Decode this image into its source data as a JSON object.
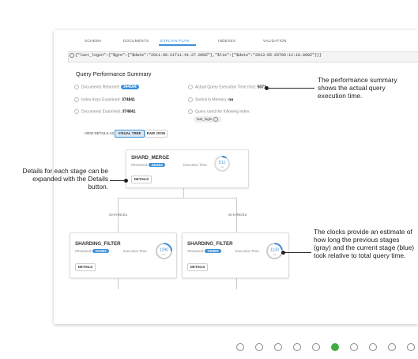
{
  "tabs": [
    {
      "label": "SCHEMA"
    },
    {
      "label": "DOCUMENTS"
    },
    {
      "label": "EXPLAIN PLAN"
    },
    {
      "label": "INDEXES"
    },
    {
      "label": "VALIDATION"
    }
  ],
  "query": "{\"last_login\":{\"$gte\":{\"$date\":\"2011-08-21T11:41:27.000Z\"},\"$lte\":{\"$date\":\"2013-05-26T06:12:18.000Z\"}}}",
  "summary": {
    "title": "Query Performance Summary",
    "docs_returned_label": "Documents Returned:",
    "docs_returned": "344164",
    "index_keys_label": "Index Keys Examined:",
    "index_keys": "374841",
    "docs_examined_label": "Documents Examined:",
    "docs_examined": "374841",
    "exec_time_label": "Actual Query Execution Time (ms):",
    "exec_time": "5071",
    "sorted_label": "Sorted in Memory:",
    "sorted": "no",
    "index_label": "Query used the following index:",
    "index_name": "last_login"
  },
  "view_details": {
    "label": "VIEW DETAILS AS",
    "visual_tree": "VISUAL TREE",
    "raw_json": "RAW JSON"
  },
  "stages": {
    "merge": {
      "title": "SHARD_MERGE",
      "nreturned_label": "nReturned:",
      "nreturned": "344164",
      "exec_label": "Execution Time:",
      "exec_ms": "511",
      "unit": "ms",
      "details": "DETAILS",
      "progress_fraction": 0.1
    },
    "shard01_label": "SHARD01",
    "shard02_label": "SHARD02",
    "filter1": {
      "title": "SHARDING_FILTER",
      "nreturned_label": "nReturned:",
      "nreturned": "213342",
      "exec_label": "Execution Time:",
      "exec_ms": "1290",
      "unit": "ms",
      "details": "DETAILS",
      "progress_fraction": 0.25
    },
    "filter2": {
      "title": "SHARDING_FILTER",
      "nreturned_label": "nReturned:",
      "nreturned": "130822",
      "exec_label": "Execution Time:",
      "exec_ms": "1130",
      "unit": "ms",
      "details": "DETAILS",
      "progress_fraction": 0.22
    }
  },
  "annotations": {
    "performance": "The performance summary shows the actual query execution time.",
    "details": "Details for each stage can be expanded with the Details button.",
    "clocks": "The clocks provide an estimate of how long the previous stages (gray) and the current stage (blue) took relative to total query time."
  },
  "pager": {
    "count": 10,
    "active_index": 5
  },
  "colors": {
    "accent": "#3b8fd6",
    "pager_active": "#3fad3f"
  }
}
